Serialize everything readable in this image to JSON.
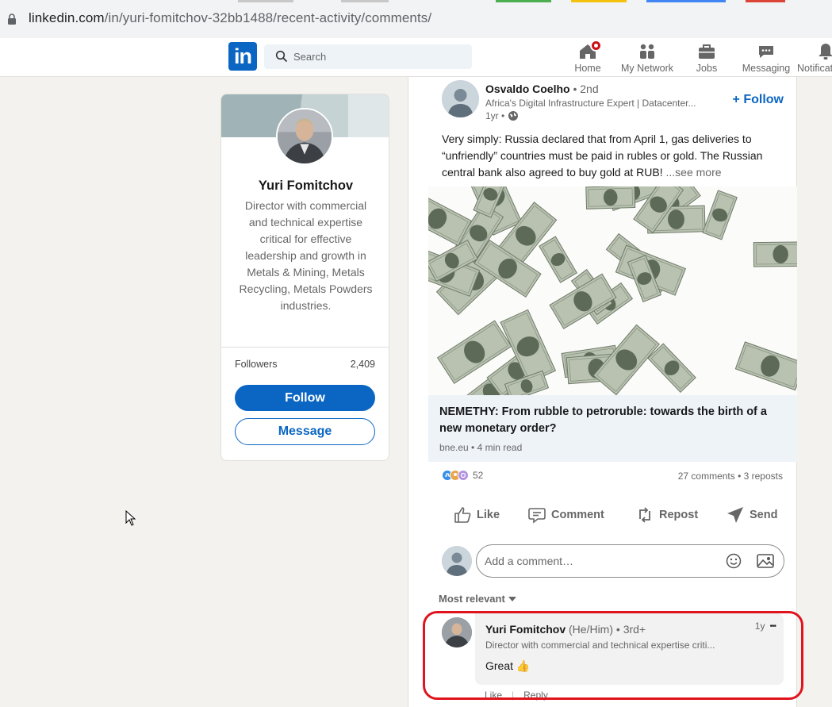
{
  "browser": {
    "url_host": "linkedin.com",
    "url_path": "/in/yuri-fomitchov-32bb1488/recent-activity/comments/"
  },
  "nav": {
    "logo": "in",
    "search_placeholder": "Search",
    "items": [
      {
        "label": "Home",
        "icon": "home-icon"
      },
      {
        "label": "My Network",
        "icon": "network-icon"
      },
      {
        "label": "Jobs",
        "icon": "briefcase-icon"
      },
      {
        "label": "Messaging",
        "icon": "messaging-icon"
      },
      {
        "label": "Notificat",
        "icon": "bell-icon"
      }
    ]
  },
  "profile": {
    "name": "Yuri Fomitchov",
    "headline": "Director with commercial and technical expertise critical for effective leadership and growth in Metals & Mining, Metals Recycling, Metals Powders industries.",
    "followers_label": "Followers",
    "followers_count": "2,409",
    "follow_label": "Follow",
    "message_label": "Message"
  },
  "post": {
    "author": "Osvaldo Coelho",
    "degree": "• 2nd",
    "author_headline": "Africa's Digital Infrastructure Expert | Datacenter...",
    "time": "1yr •",
    "follow_label": "+ Follow",
    "text": "Very simply: Russia declared that from April 1, gas deliveries to “unfriendly” countries must be paid in rubles or gold. The Russian central bank also agreed to buy gold at RUB!",
    "see_more": "...see more",
    "article_title": "NEMETHY: From rubble to petroruble: towards the birth of a new monetary order?",
    "article_source": "bne.eu • 4 min read",
    "reaction_count": "52",
    "stats": "27 comments • 3 reposts",
    "actions": [
      "Like",
      "Comment",
      "Repost",
      "Send"
    ],
    "comment_placeholder": "Add a comment…",
    "sort_label": "Most relevant"
  },
  "comment": {
    "author": "Yuri Fomitchov",
    "pronouns": "(He/Him)",
    "degree": "• 3rd+",
    "headline": "Director with commercial and technical expertise criti...",
    "time": "1y",
    "more": "•••",
    "text": "Great 👍",
    "like": "Like",
    "reply": "Reply"
  },
  "colors": {
    "brand": "#0a66c2",
    "highlight": "#e0141e",
    "badge": "#cc1016"
  }
}
